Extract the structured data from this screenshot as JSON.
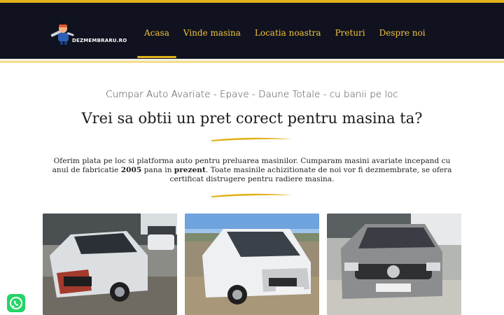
{
  "brand": {
    "logo_text": "DEZMEMBRARU.RO"
  },
  "nav": {
    "items": [
      {
        "label": "Acasa",
        "active": true
      },
      {
        "label": "Vinde masina"
      },
      {
        "label": "Locatia noastra"
      },
      {
        "label": "Preturi"
      },
      {
        "label": "Despre noi"
      }
    ]
  },
  "hero": {
    "subtitle": "Cumpar Auto Avariate - Epave - Daune Totale - cu banii pe loc",
    "headline": "Vrei sa obtii un pret corect pentru masina ta?",
    "para_part1": "Oferim plata pe loc si platforma auto pentru preluarea masinilor. Cumparam masini avariate incepand cu anul de fabricatie ",
    "para_year": "2005",
    "para_part2": " pana in ",
    "para_present": "prezent",
    "para_part3": ". Toate masinile achizitionate de noi vor fi dezmembrate, se ofera certificat distrugere pentru radiere masina."
  },
  "photos": [
    {
      "name": "damaged-mercedes-photo"
    },
    {
      "name": "damaged-dacia-photo"
    },
    {
      "name": "damaged-vw-passat-photo"
    }
  ],
  "colors": {
    "accent": "#e0b21c",
    "header_bg": "#10121f",
    "nav_text": "#f0c33a",
    "whatsapp": "#25d366"
  },
  "icons": {
    "whatsapp": "whatsapp-icon",
    "logo": "mechanic-mascot-icon"
  }
}
